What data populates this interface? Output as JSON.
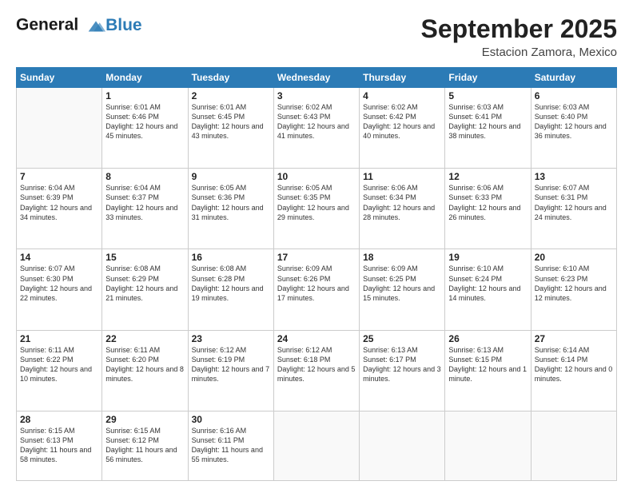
{
  "logo": {
    "line1": "General",
    "line2": "Blue"
  },
  "title": "September 2025",
  "subtitle": "Estacion Zamora, Mexico",
  "days_of_week": [
    "Sunday",
    "Monday",
    "Tuesday",
    "Wednesday",
    "Thursday",
    "Friday",
    "Saturday"
  ],
  "weeks": [
    [
      {
        "day": "",
        "sunrise": "",
        "sunset": "",
        "daylight": ""
      },
      {
        "day": "1",
        "sunrise": "Sunrise: 6:01 AM",
        "sunset": "Sunset: 6:46 PM",
        "daylight": "Daylight: 12 hours and 45 minutes."
      },
      {
        "day": "2",
        "sunrise": "Sunrise: 6:01 AM",
        "sunset": "Sunset: 6:45 PM",
        "daylight": "Daylight: 12 hours and 43 minutes."
      },
      {
        "day": "3",
        "sunrise": "Sunrise: 6:02 AM",
        "sunset": "Sunset: 6:43 PM",
        "daylight": "Daylight: 12 hours and 41 minutes."
      },
      {
        "day": "4",
        "sunrise": "Sunrise: 6:02 AM",
        "sunset": "Sunset: 6:42 PM",
        "daylight": "Daylight: 12 hours and 40 minutes."
      },
      {
        "day": "5",
        "sunrise": "Sunrise: 6:03 AM",
        "sunset": "Sunset: 6:41 PM",
        "daylight": "Daylight: 12 hours and 38 minutes."
      },
      {
        "day": "6",
        "sunrise": "Sunrise: 6:03 AM",
        "sunset": "Sunset: 6:40 PM",
        "daylight": "Daylight: 12 hours and 36 minutes."
      }
    ],
    [
      {
        "day": "7",
        "sunrise": "Sunrise: 6:04 AM",
        "sunset": "Sunset: 6:39 PM",
        "daylight": "Daylight: 12 hours and 34 minutes."
      },
      {
        "day": "8",
        "sunrise": "Sunrise: 6:04 AM",
        "sunset": "Sunset: 6:37 PM",
        "daylight": "Daylight: 12 hours and 33 minutes."
      },
      {
        "day": "9",
        "sunrise": "Sunrise: 6:05 AM",
        "sunset": "Sunset: 6:36 PM",
        "daylight": "Daylight: 12 hours and 31 minutes."
      },
      {
        "day": "10",
        "sunrise": "Sunrise: 6:05 AM",
        "sunset": "Sunset: 6:35 PM",
        "daylight": "Daylight: 12 hours and 29 minutes."
      },
      {
        "day": "11",
        "sunrise": "Sunrise: 6:06 AM",
        "sunset": "Sunset: 6:34 PM",
        "daylight": "Daylight: 12 hours and 28 minutes."
      },
      {
        "day": "12",
        "sunrise": "Sunrise: 6:06 AM",
        "sunset": "Sunset: 6:33 PM",
        "daylight": "Daylight: 12 hours and 26 minutes."
      },
      {
        "day": "13",
        "sunrise": "Sunrise: 6:07 AM",
        "sunset": "Sunset: 6:31 PM",
        "daylight": "Daylight: 12 hours and 24 minutes."
      }
    ],
    [
      {
        "day": "14",
        "sunrise": "Sunrise: 6:07 AM",
        "sunset": "Sunset: 6:30 PM",
        "daylight": "Daylight: 12 hours and 22 minutes."
      },
      {
        "day": "15",
        "sunrise": "Sunrise: 6:08 AM",
        "sunset": "Sunset: 6:29 PM",
        "daylight": "Daylight: 12 hours and 21 minutes."
      },
      {
        "day": "16",
        "sunrise": "Sunrise: 6:08 AM",
        "sunset": "Sunset: 6:28 PM",
        "daylight": "Daylight: 12 hours and 19 minutes."
      },
      {
        "day": "17",
        "sunrise": "Sunrise: 6:09 AM",
        "sunset": "Sunset: 6:26 PM",
        "daylight": "Daylight: 12 hours and 17 minutes."
      },
      {
        "day": "18",
        "sunrise": "Sunrise: 6:09 AM",
        "sunset": "Sunset: 6:25 PM",
        "daylight": "Daylight: 12 hours and 15 minutes."
      },
      {
        "day": "19",
        "sunrise": "Sunrise: 6:10 AM",
        "sunset": "Sunset: 6:24 PM",
        "daylight": "Daylight: 12 hours and 14 minutes."
      },
      {
        "day": "20",
        "sunrise": "Sunrise: 6:10 AM",
        "sunset": "Sunset: 6:23 PM",
        "daylight": "Daylight: 12 hours and 12 minutes."
      }
    ],
    [
      {
        "day": "21",
        "sunrise": "Sunrise: 6:11 AM",
        "sunset": "Sunset: 6:22 PM",
        "daylight": "Daylight: 12 hours and 10 minutes."
      },
      {
        "day": "22",
        "sunrise": "Sunrise: 6:11 AM",
        "sunset": "Sunset: 6:20 PM",
        "daylight": "Daylight: 12 hours and 8 minutes."
      },
      {
        "day": "23",
        "sunrise": "Sunrise: 6:12 AM",
        "sunset": "Sunset: 6:19 PM",
        "daylight": "Daylight: 12 hours and 7 minutes."
      },
      {
        "day": "24",
        "sunrise": "Sunrise: 6:12 AM",
        "sunset": "Sunset: 6:18 PM",
        "daylight": "Daylight: 12 hours and 5 minutes."
      },
      {
        "day": "25",
        "sunrise": "Sunrise: 6:13 AM",
        "sunset": "Sunset: 6:17 PM",
        "daylight": "Daylight: 12 hours and 3 minutes."
      },
      {
        "day": "26",
        "sunrise": "Sunrise: 6:13 AM",
        "sunset": "Sunset: 6:15 PM",
        "daylight": "Daylight: 12 hours and 1 minute."
      },
      {
        "day": "27",
        "sunrise": "Sunrise: 6:14 AM",
        "sunset": "Sunset: 6:14 PM",
        "daylight": "Daylight: 12 hours and 0 minutes."
      }
    ],
    [
      {
        "day": "28",
        "sunrise": "Sunrise: 6:15 AM",
        "sunset": "Sunset: 6:13 PM",
        "daylight": "Daylight: 11 hours and 58 minutes."
      },
      {
        "day": "29",
        "sunrise": "Sunrise: 6:15 AM",
        "sunset": "Sunset: 6:12 PM",
        "daylight": "Daylight: 11 hours and 56 minutes."
      },
      {
        "day": "30",
        "sunrise": "Sunrise: 6:16 AM",
        "sunset": "Sunset: 6:11 PM",
        "daylight": "Daylight: 11 hours and 55 minutes."
      },
      {
        "day": "",
        "sunrise": "",
        "sunset": "",
        "daylight": ""
      },
      {
        "day": "",
        "sunrise": "",
        "sunset": "",
        "daylight": ""
      },
      {
        "day": "",
        "sunrise": "",
        "sunset": "",
        "daylight": ""
      },
      {
        "day": "",
        "sunrise": "",
        "sunset": "",
        "daylight": ""
      }
    ]
  ]
}
